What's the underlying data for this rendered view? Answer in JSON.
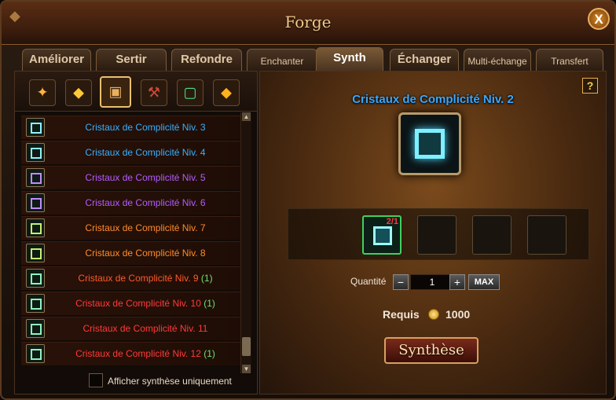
{
  "window": {
    "title": "Forge",
    "close_glyph": "X"
  },
  "tabs": [
    {
      "label": "Améliorer",
      "active": false
    },
    {
      "label": "Sertir",
      "active": false
    },
    {
      "label": "Refondre",
      "active": false
    },
    {
      "label": "Enchanter",
      "active": false
    },
    {
      "label": "Synth",
      "active": true
    },
    {
      "label": "Échanger",
      "active": false
    },
    {
      "label": "Multi-échange",
      "active": false
    },
    {
      "label": "Transfert",
      "active": false
    }
  ],
  "categories": [
    {
      "icon": "scroll-icon",
      "active": false
    },
    {
      "icon": "gold-crystal-icon",
      "active": false
    },
    {
      "icon": "treasure-chest-icon",
      "active": true
    },
    {
      "icon": "hammer-icon",
      "active": false
    },
    {
      "icon": "green-gem-icon",
      "active": false
    },
    {
      "icon": "topaz-icon",
      "active": false
    }
  ],
  "list": [
    {
      "name": "Cristaux de Complicité Niv. 3",
      "count": "",
      "color": "#3ab0ff"
    },
    {
      "name": "Cristaux de Complicité Niv. 4",
      "count": "",
      "color": "#3ab0ff"
    },
    {
      "name": "Cristaux de Complicité Niv. 5",
      "count": "",
      "color": "#b45cff"
    },
    {
      "name": "Cristaux de Complicité Niv. 6",
      "count": "",
      "color": "#b45cff"
    },
    {
      "name": "Cristaux de Complicité Niv. 7",
      "count": "",
      "color": "#ff8c2a"
    },
    {
      "name": "Cristaux de Complicité Niv. 8",
      "count": "",
      "color": "#ff8c2a"
    },
    {
      "name": "Cristaux de Complicité Niv. 9",
      "count": "(1)",
      "color": "#ff5a2a"
    },
    {
      "name": "Cristaux de Complicité Niv. 10",
      "count": "(1)",
      "color": "#ff3a3a"
    },
    {
      "name": "Cristaux de Complicité Niv. 11",
      "count": "",
      "color": "#ff3a3a"
    },
    {
      "name": "Cristaux de Complicité Niv. 12",
      "count": "(1)",
      "color": "#ff3a3a"
    }
  ],
  "filter": {
    "label": "Afficher synthèse uniquement",
    "checked": false
  },
  "synth": {
    "help": "?",
    "target_name": "Cristaux de Complicité Niv. 2",
    "materials": [
      {
        "filled": true,
        "count": "2/1"
      },
      {
        "filled": false,
        "count": ""
      },
      {
        "filled": false,
        "count": ""
      },
      {
        "filled": false,
        "count": ""
      }
    ],
    "quantity_label": "Quantité",
    "quantity": "1",
    "minus": "−",
    "plus": "+",
    "max_label": "MAX",
    "required_label": "Requis",
    "required_cost": "1000",
    "synth_button": "Synthèse"
  }
}
